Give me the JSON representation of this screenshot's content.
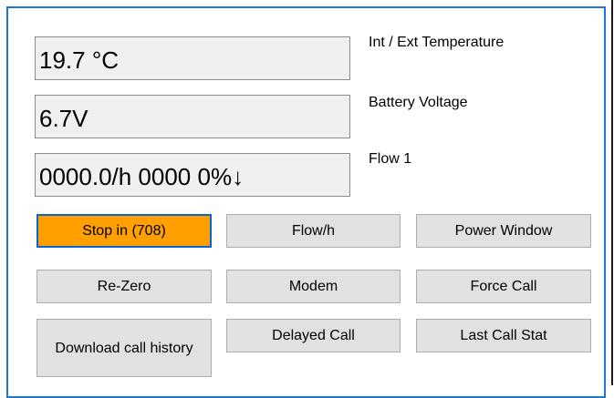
{
  "readouts": {
    "temperature": {
      "value": "19.7 °C",
      "label": "Int / Ext Temperature"
    },
    "battery": {
      "value": "6.7V",
      "label": "Battery Voltage"
    },
    "flow": {
      "value": "0000.0/h  0000  0%↓",
      "label": "Flow 1"
    }
  },
  "buttons": {
    "stop": "Stop in (708)",
    "flow_h": "Flow/h",
    "power_window": "Power Window",
    "re_zero": "Re-Zero",
    "modem": "Modem",
    "force_call": "Force Call",
    "download_call_history": "Download call history",
    "delayed_call": "Delayed Call",
    "last_call_stat": "Last Call Stat"
  },
  "colors": {
    "active_button": "#ff9f00",
    "focus_border": "#0a64d8",
    "frame_border": "#1e78d2"
  }
}
